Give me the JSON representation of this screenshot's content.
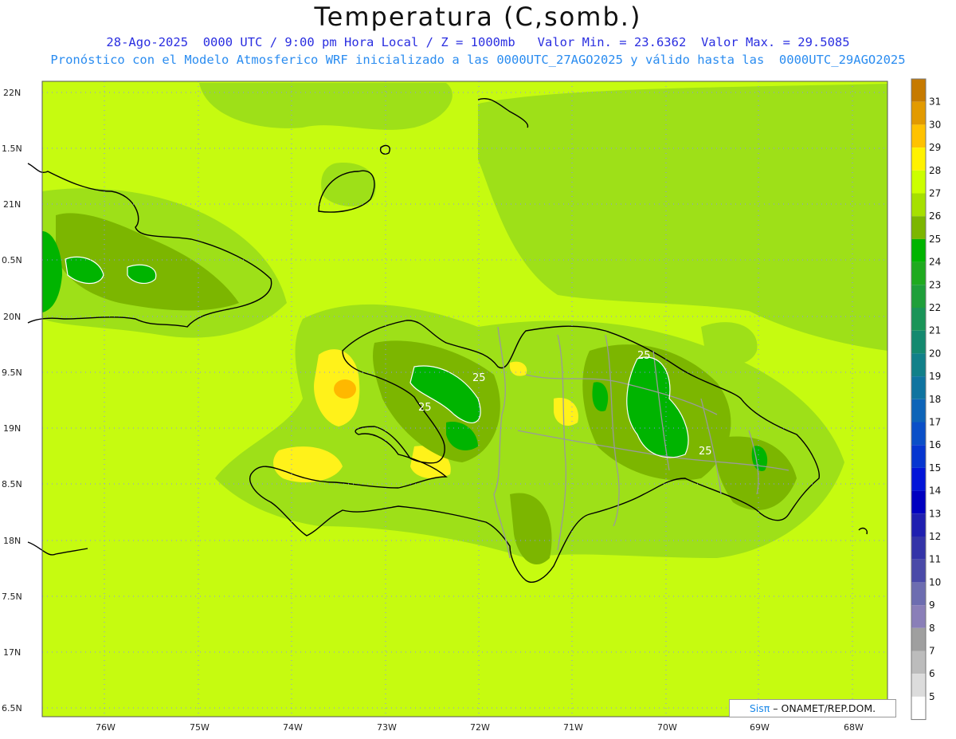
{
  "header": {
    "title": "Temperatura (C,somb.)",
    "line1": "28-Ago-2025  0000 UTC / 9:00 pm Hora Local / Z = 1000mb   Valor Min. = 23.6362  Valor Max. = 29.5085",
    "line2": "Pronóstico con el Modelo Atmosferico WRF inicializado a las 0000UTC_27AGO2025 y válido hasta las  0000UTC_29AGO2025"
  },
  "axes": {
    "lat_labels": [
      "22N",
      "1.5N",
      "21N",
      "0.5N",
      "20N",
      "9.5N",
      "19N",
      "8.5N",
      "18N",
      "7.5N",
      "17N",
      "6.5N"
    ],
    "lon_labels": [
      "76W",
      "75W",
      "74W",
      "73W",
      "72W",
      "71W",
      "70W",
      "69W",
      "68W"
    ]
  },
  "colorbar": {
    "labels": [
      "31",
      "30",
      "29",
      "28",
      "27",
      "26",
      "25",
      "24",
      "23",
      "22",
      "21",
      "20",
      "19",
      "18",
      "17",
      "16",
      "15",
      "14",
      "13",
      "12",
      "11",
      "10",
      "9",
      "8",
      "7",
      "6",
      "5"
    ],
    "colors": [
      "#c67a00",
      "#e29a00",
      "#ffc200",
      "#fff200",
      "#ccff00",
      "#a6e000",
      "#7cb600",
      "#00b400",
      "#1faa1f",
      "#1f9f3a",
      "#1a9458",
      "#14896f",
      "#118089",
      "#0f74a0",
      "#0d64b8",
      "#0a4fc8",
      "#0636d0",
      "#0215d8",
      "#0000c0",
      "#1f1fb0",
      "#3434a8",
      "#4a4aa8",
      "#6d6db0",
      "#8a7fb8",
      "#9f9f9f",
      "#bcbcbc",
      "#dcdcdc",
      "#ffffff"
    ]
  },
  "map": {
    "contour_label": "25"
  },
  "credit": {
    "sis": "Sisπ",
    "text": "– ONAMET/REP.DOM."
  }
}
